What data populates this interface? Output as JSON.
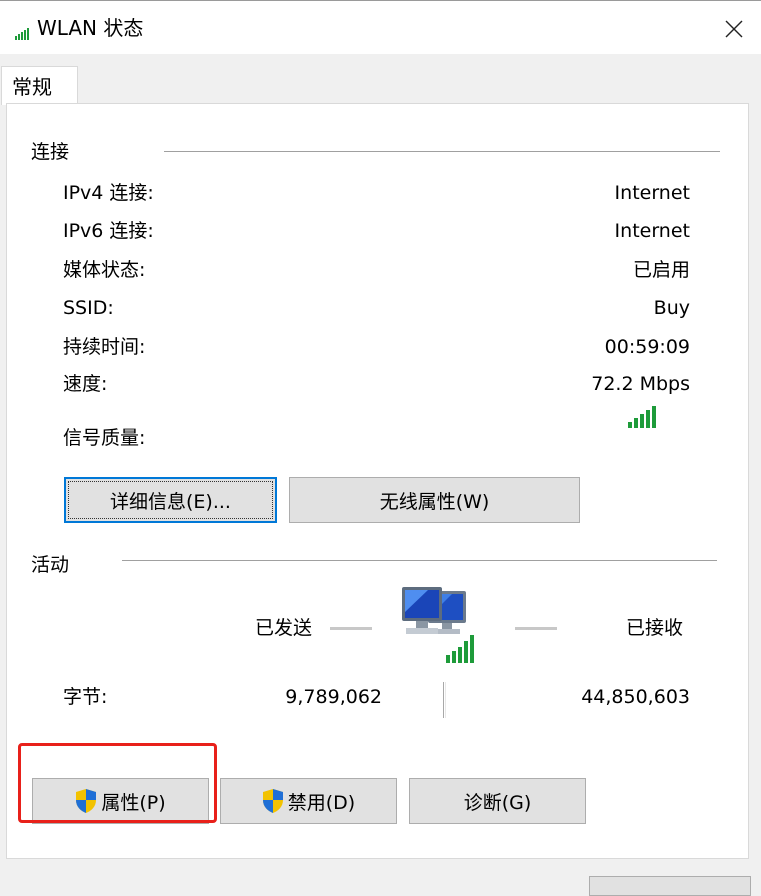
{
  "window": {
    "title": "WLAN 状态"
  },
  "tabs": [
    {
      "label": "常规"
    }
  ],
  "connection": {
    "section_label": "连接",
    "rows": [
      {
        "label": "IPv4 连接:",
        "value": "Internet"
      },
      {
        "label": "IPv6 连接:",
        "value": "Internet"
      },
      {
        "label": "媒体状态:",
        "value": "已启用"
      },
      {
        "label": "SSID:",
        "value": "Buy"
      },
      {
        "label": "持续时间:",
        "value": "00:59:09"
      },
      {
        "label": "速度:",
        "value": "72.2 Mbps"
      }
    ],
    "signal_label": "信号质量:",
    "signal_bars": 5,
    "details_button": "详细信息(E)...",
    "wireless_props_button": "无线属性(W)"
  },
  "activity": {
    "section_label": "活动",
    "sent_label": "已发送",
    "received_label": "已接收",
    "bytes_label": "字节:",
    "bytes_sent": "9,789,062",
    "bytes_received": "44,850,603"
  },
  "actions": {
    "properties_button": "属性(P)",
    "disable_button": "禁用(D)",
    "diagnose_button": "诊断(G)"
  },
  "colors": {
    "accent": "#0078d7",
    "highlight": "#e8201a",
    "signal": "#1e9b3a"
  }
}
